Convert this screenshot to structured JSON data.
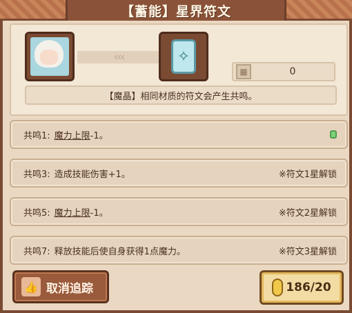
{
  "title": "【蓄能】星界符文",
  "header": {
    "arrows": "‹‹‹",
    "counter_value": "0",
    "note": "【魔晶】相同材质的符文会产生共鸣。"
  },
  "rows": [
    {
      "label": "共鸣1:",
      "pre": "",
      "link": "魔力上限",
      "post": "-1。",
      "lock": "",
      "active": true
    },
    {
      "label": "共鸣3:",
      "pre": "造成技能伤害+1。",
      "link": "",
      "post": "",
      "lock": "※符文1星解锁",
      "active": false
    },
    {
      "label": "共鸣5:",
      "pre": "",
      "link": "魔力上限",
      "post": "-1。",
      "lock": "※符文2星解锁",
      "active": false
    },
    {
      "label": "共鸣7:",
      "pre": "释放技能后使自身获得1点魔力。",
      "link": "",
      "post": "",
      "lock": "※符文3星解锁",
      "active": false
    }
  ],
  "buttons": {
    "cancel_label": "取消追踪",
    "cost_label": "186/20"
  },
  "colors": {
    "title_bg": "#8a5339",
    "panel_bg": "#ead8c2",
    "row_bg": "#e5d3bd",
    "active_dot": "#7ed07a",
    "cost_button": "#f3dca4"
  },
  "icons": [
    "character-portrait",
    "rune-card-icon",
    "counter-icon",
    "thumbs-up-icon",
    "crystal-icon",
    "active-indicator-icon"
  ]
}
